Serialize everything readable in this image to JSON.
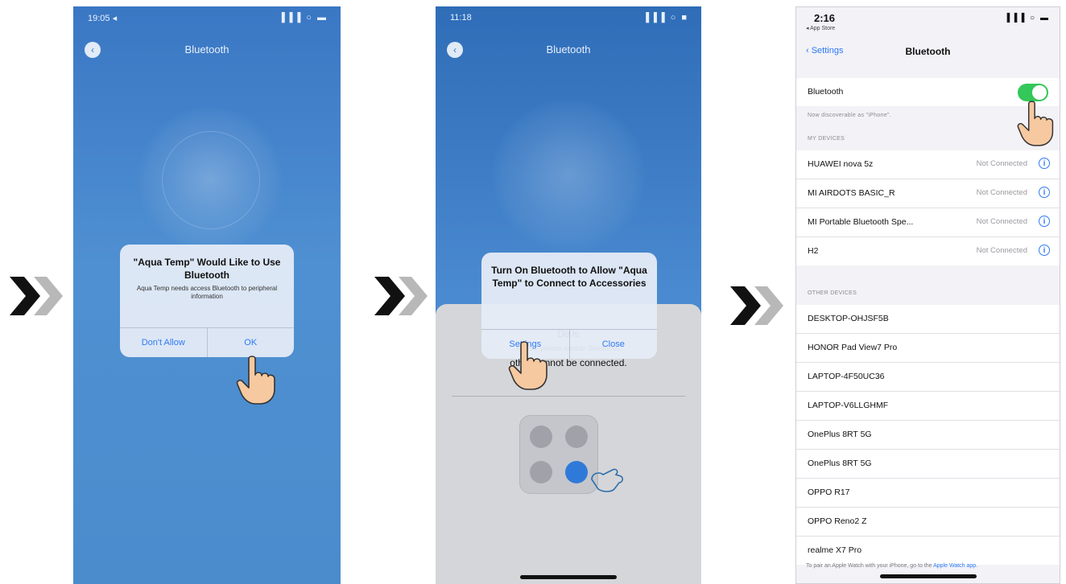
{
  "phone1": {
    "status_time": "19:05 ◂",
    "status_right": "▐▐▐ ○ ▬",
    "title": "Bluetooth",
    "alert": {
      "title": "\"Aqua Temp\" Would Like to Use Bluetooth",
      "message": "Aqua Temp needs access Bluetooth to peripheral information",
      "deny": "Don't Allow",
      "ok": "OK"
    }
  },
  "phone2": {
    "status_time": "11:18",
    "status_right": "▐▐▐ ○ ■",
    "title": "Bluetooth",
    "alert": {
      "title": "Turn On Bluetooth to Allow \"Aqua Temp\" to Connect to Accessories",
      "settings": "Settings",
      "close": "Close"
    },
    "sheet": {
      "line1": "De                                    is",
      "line2": "not on, please enable Bluetooth,",
      "line3": "other          cannot be connected."
    }
  },
  "phone3": {
    "time": "2:16",
    "sub_status": "◂ App Store",
    "indicators": "▐▐▐ ○ ▬",
    "nav_back": "‹ Settings",
    "nav_title": "Bluetooth",
    "bluetooth_label": "Bluetooth",
    "discoverable": "Now discoverable as \"iPhone\".",
    "my_devices_header": "MY DEVICES",
    "status_not_connected": "Not Connected",
    "my_devices": [
      {
        "name": "HUAWEI nova 5z"
      },
      {
        "name": "MI AIRDOTS BASIC_R"
      },
      {
        "name": "MI Portable Bluetooth Spe..."
      },
      {
        "name": "H2"
      }
    ],
    "other_devices_header": "OTHER DEVICES",
    "other_devices": [
      {
        "name": "DESKTOP-OHJSF5B"
      },
      {
        "name": "HONOR Pad View7 Pro"
      },
      {
        "name": "LAPTOP-4F50UC36"
      },
      {
        "name": "LAPTOP-V6LLGHMF"
      },
      {
        "name": "OnePlus 8RT 5G"
      },
      {
        "name": "OnePlus 8RT 5G"
      },
      {
        "name": "OPPO R17"
      },
      {
        "name": "OPPO Reno2 Z"
      },
      {
        "name": "realme X7 Pro"
      }
    ],
    "footnote": "To pair an Apple Watch with your iPhone, go to the",
    "footnote_link": "Apple Watch app."
  }
}
